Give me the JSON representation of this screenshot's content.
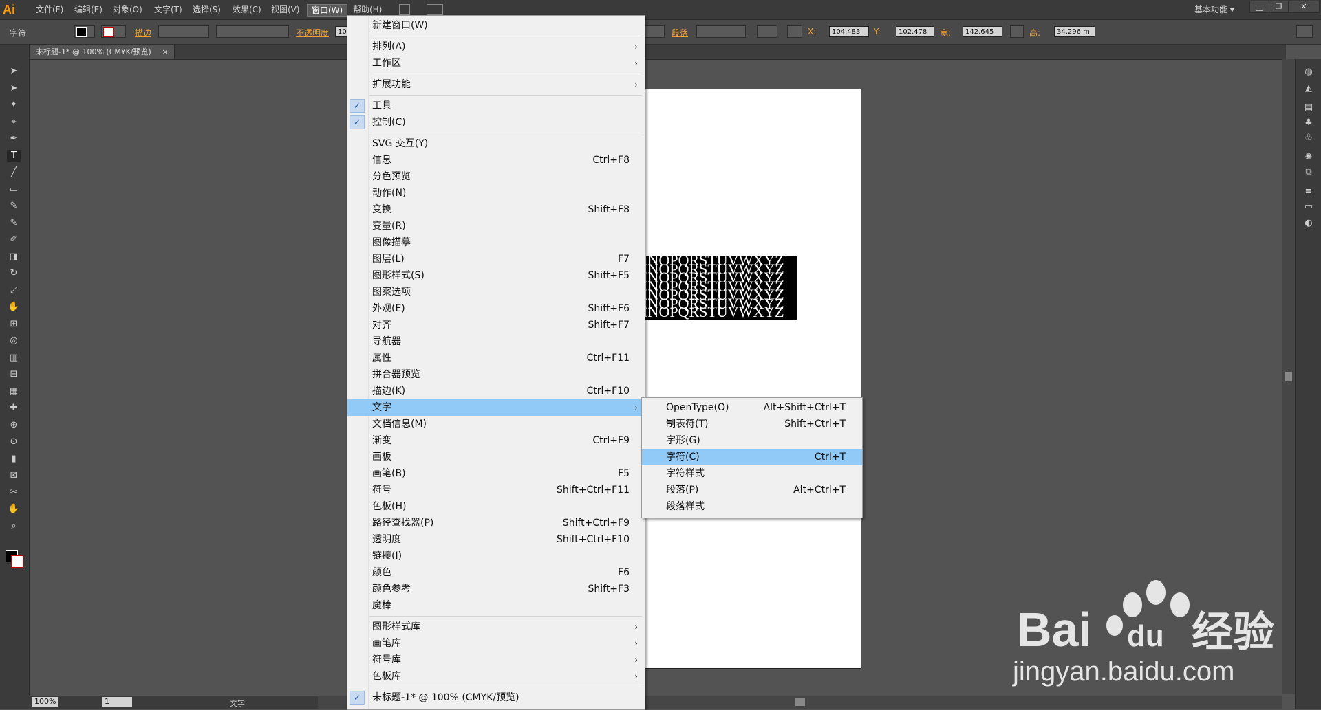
{
  "app": {
    "logo": "Ai",
    "workspace": "基本功能"
  },
  "menubar": [
    {
      "label": "文件(F)"
    },
    {
      "label": "编辑(E)"
    },
    {
      "label": "对象(O)"
    },
    {
      "label": "文字(T)"
    },
    {
      "label": "选择(S)"
    },
    {
      "label": "效果(C)"
    },
    {
      "label": "视图(V)"
    },
    {
      "label": "窗口(W)",
      "active": true
    },
    {
      "label": "帮助(H)"
    }
  ],
  "controlbar": {
    "tool_name": "字符",
    "stroke_label": "描边",
    "opacity_label": "不透明度",
    "opacity_value": "10",
    "paragraph_label": "段落",
    "x_label": "X:",
    "x_value": "104.483",
    "y_label": "Y:",
    "y_value": "102.478",
    "w_label": "宽:",
    "w_value": "142.645",
    "h_label": "高:",
    "h_value": "34.296 m"
  },
  "document": {
    "tab_title": "未标题-1* @ 100% (CMYK/预览)",
    "close": "×"
  },
  "statusbar": {
    "zoom": "100%",
    "page": "1",
    "tool": "文字"
  },
  "canvas_text": [
    "MNOPQRSTUVWXYZ",
    "MNOPQRSTUVWXYZ",
    "MNOPQRSTUVWXYZ",
    "MNOPQRSTUVWXYZ",
    "MNOPQRSTUVWXYZ",
    "MNOPQRSTUVWXYZ",
    "MNOPQRSTUVWXYZ"
  ],
  "window_menu": [
    {
      "label": "新建窗口(W)"
    },
    {
      "sep": true
    },
    {
      "label": "排列(A)",
      "submenu": true
    },
    {
      "label": "工作区",
      "submenu": true
    },
    {
      "sep": true
    },
    {
      "label": "扩展功能",
      "submenu": true
    },
    {
      "sep": true
    },
    {
      "label": "工具",
      "checked": true
    },
    {
      "label": "控制(C)",
      "checked": true
    },
    {
      "sep": true
    },
    {
      "label": "SVG 交互(Y)"
    },
    {
      "label": "信息",
      "shortcut": "Ctrl+F8"
    },
    {
      "label": "分色预览"
    },
    {
      "label": "动作(N)"
    },
    {
      "label": "变换",
      "shortcut": "Shift+F8"
    },
    {
      "label": "变量(R)"
    },
    {
      "label": "图像描摹"
    },
    {
      "label": "图层(L)",
      "shortcut": "F7"
    },
    {
      "label": "图形样式(S)",
      "shortcut": "Shift+F5"
    },
    {
      "label": "图案选项"
    },
    {
      "label": "外观(E)",
      "shortcut": "Shift+F6"
    },
    {
      "label": "对齐",
      "shortcut": "Shift+F7"
    },
    {
      "label": "导航器"
    },
    {
      "label": "属性",
      "shortcut": "Ctrl+F11"
    },
    {
      "label": "拼合器预览"
    },
    {
      "label": "描边(K)",
      "shortcut": "Ctrl+F10"
    },
    {
      "label": "文字",
      "submenu": true,
      "highlighted": true
    },
    {
      "label": "文档信息(M)"
    },
    {
      "label": "渐变",
      "shortcut": "Ctrl+F9"
    },
    {
      "label": "画板"
    },
    {
      "label": "画笔(B)",
      "shortcut": "F5"
    },
    {
      "label": "符号",
      "shortcut": "Shift+Ctrl+F11"
    },
    {
      "label": "色板(H)"
    },
    {
      "label": "路径查找器(P)",
      "shortcut": "Shift+Ctrl+F9"
    },
    {
      "label": "透明度",
      "shortcut": "Shift+Ctrl+F10"
    },
    {
      "label": "链接(I)"
    },
    {
      "label": "颜色",
      "shortcut": "F6"
    },
    {
      "label": "颜色参考",
      "shortcut": "Shift+F3"
    },
    {
      "label": "魔棒"
    },
    {
      "sep": true
    },
    {
      "label": "图形样式库",
      "submenu": true
    },
    {
      "label": "画笔库",
      "submenu": true
    },
    {
      "label": "符号库",
      "submenu": true
    },
    {
      "label": "色板库",
      "submenu": true
    },
    {
      "sep": true
    },
    {
      "label": "未标题-1* @ 100% (CMYK/预览)",
      "checked": true
    }
  ],
  "type_submenu": [
    {
      "label": "OpenType(O)",
      "shortcut": "Alt+Shift+Ctrl+T"
    },
    {
      "label": "制表符(T)",
      "shortcut": "Shift+Ctrl+T"
    },
    {
      "label": "字形(G)"
    },
    {
      "label": "字符(C)",
      "shortcut": "Ctrl+T",
      "highlighted": true
    },
    {
      "label": "字符样式"
    },
    {
      "label": "段落(P)",
      "shortcut": "Alt+Ctrl+T"
    },
    {
      "label": "段落样式"
    }
  ],
  "watermark": {
    "brand": "Bai",
    "paw": "du",
    "cn": "经验",
    "url": "jingyan.baidu.com"
  },
  "colors": {
    "highlight": "#91c9f7",
    "menu_bg": "#f0f0f0",
    "ui_dark": "#3b3b3b",
    "accent": "#ff9a00"
  }
}
